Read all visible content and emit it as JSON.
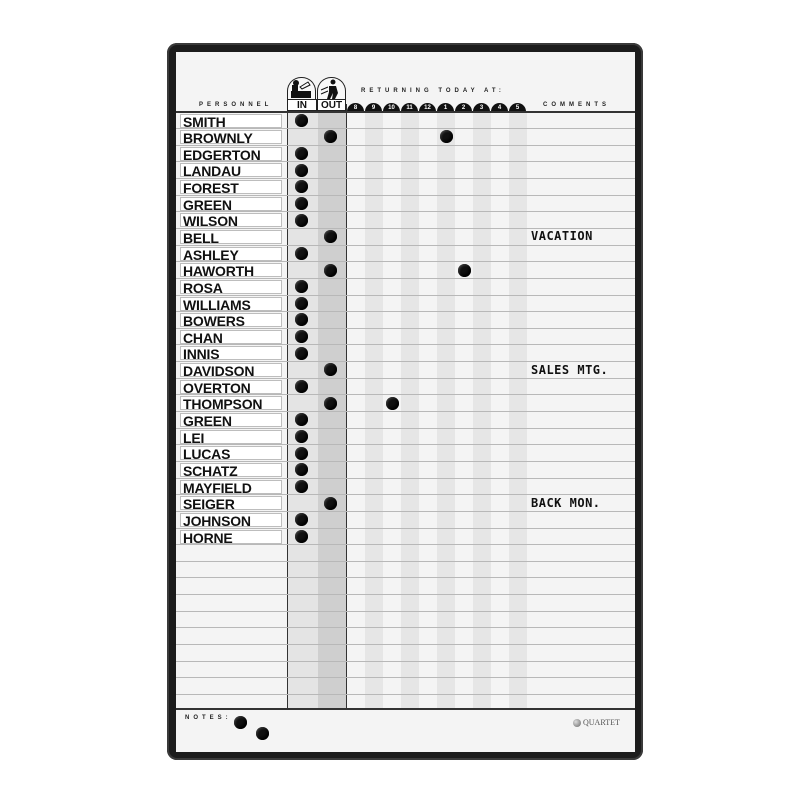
{
  "board": {
    "headers": {
      "personnel": "PERSONNEL",
      "in": "IN",
      "out": "OUT",
      "returning": "RETURNING TODAY AT:",
      "comments": "COMMENTS",
      "notes": "NOTES:"
    },
    "hours": [
      "8",
      "9",
      "10",
      "11",
      "12",
      "1",
      "2",
      "3",
      "4",
      "5"
    ],
    "personnel": [
      {
        "name": "SMITH",
        "status": "in",
        "return_hour": null,
        "comment": ""
      },
      {
        "name": "BROWNLY",
        "status": "out",
        "return_hour": "1",
        "comment": ""
      },
      {
        "name": "EDGERTON",
        "status": "in",
        "return_hour": null,
        "comment": ""
      },
      {
        "name": "LANDAU",
        "status": "in",
        "return_hour": null,
        "comment": ""
      },
      {
        "name": "FOREST",
        "status": "in",
        "return_hour": null,
        "comment": ""
      },
      {
        "name": "GREEN",
        "status": "in",
        "return_hour": null,
        "comment": ""
      },
      {
        "name": "WILSON",
        "status": "in",
        "return_hour": null,
        "comment": ""
      },
      {
        "name": "BELL",
        "status": "out",
        "return_hour": null,
        "comment": "VACATION"
      },
      {
        "name": "ASHLEY",
        "status": "in",
        "return_hour": null,
        "comment": ""
      },
      {
        "name": "HAWORTH",
        "status": "out",
        "return_hour": "2",
        "comment": ""
      },
      {
        "name": "ROSA",
        "status": "in",
        "return_hour": null,
        "comment": ""
      },
      {
        "name": "WILLIAMS",
        "status": "in",
        "return_hour": null,
        "comment": ""
      },
      {
        "name": "BOWERS",
        "status": "in",
        "return_hour": null,
        "comment": ""
      },
      {
        "name": "CHAN",
        "status": "in",
        "return_hour": null,
        "comment": ""
      },
      {
        "name": "INNIS",
        "status": "in",
        "return_hour": null,
        "comment": ""
      },
      {
        "name": "DAVIDSON",
        "status": "out",
        "return_hour": null,
        "comment": "SALES MTG."
      },
      {
        "name": "OVERTON",
        "status": "in",
        "return_hour": null,
        "comment": ""
      },
      {
        "name": "THOMPSON",
        "status": "out",
        "return_hour": "10",
        "comment": ""
      },
      {
        "name": "GREEN",
        "status": "in",
        "return_hour": null,
        "comment": ""
      },
      {
        "name": "LEI",
        "status": "in",
        "return_hour": null,
        "comment": ""
      },
      {
        "name": "LUCAS",
        "status": "in",
        "return_hour": null,
        "comment": ""
      },
      {
        "name": "SCHATZ",
        "status": "in",
        "return_hour": null,
        "comment": ""
      },
      {
        "name": "MAYFIELD",
        "status": "in",
        "return_hour": null,
        "comment": ""
      },
      {
        "name": "SEIGER",
        "status": "out",
        "return_hour": null,
        "comment": "BACK MON."
      },
      {
        "name": "JOHNSON",
        "status": "in",
        "return_hour": null,
        "comment": ""
      },
      {
        "name": "HORNE",
        "status": "in",
        "return_hour": null,
        "comment": ""
      }
    ],
    "empty_rows": 10,
    "spare_magnets": 2,
    "brand": "QUARTET",
    "colors": {
      "frame": "#1c1c1c",
      "board": "#f4f4f4",
      "out_column": "#cfcfcf",
      "in_column": "#e4e4e4",
      "magnet": "#111111"
    }
  }
}
